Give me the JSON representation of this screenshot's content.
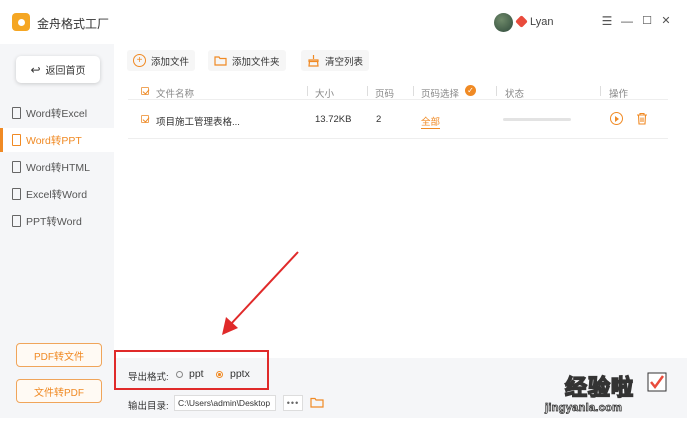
{
  "app": {
    "title": "金舟格式工厂",
    "username": "Lyan"
  },
  "window_controls": {
    "menu": "☰",
    "minimize": "—",
    "maximize": "☐",
    "close": "✕"
  },
  "sidebar": {
    "back_label": "返回首页",
    "items": [
      {
        "label": "Word转Excel"
      },
      {
        "label": "Word转PPT"
      },
      {
        "label": "Word转HTML"
      },
      {
        "label": "Excel转Word"
      },
      {
        "label": "PPT转Word"
      }
    ],
    "active_index": 1,
    "bottom_buttons": [
      {
        "label": "PDF转文件"
      },
      {
        "label": "文件转PDF"
      }
    ]
  },
  "toolbar": {
    "add_file": "添加文件",
    "add_folder": "添加文件夹",
    "clear_list": "清空列表"
  },
  "table": {
    "headers": {
      "name": "文件名称",
      "size": "大小",
      "pages": "页码",
      "page_select": "页码选择",
      "status": "状态",
      "actions": "操作"
    },
    "rows": [
      {
        "name": "项目施工管理表格...",
        "size": "13.72KB",
        "pages": "2",
        "page_select": "全部",
        "progress": 0.0
      }
    ]
  },
  "export": {
    "format_label": "导出格式:",
    "options": [
      {
        "label": "ppt",
        "selected": false
      },
      {
        "label": "pptx",
        "selected": true
      }
    ],
    "output_label": "输出目录:",
    "output_path": "C:\\Users\\admin\\Desktop",
    "browse_label": "•••"
  },
  "watermark": {
    "text": "经验啦",
    "url": "jingyanla.com"
  },
  "colors": {
    "accent": "#f08a24",
    "annotation": "#e02a2a",
    "sidebar_bg": "#f5f6f8"
  }
}
